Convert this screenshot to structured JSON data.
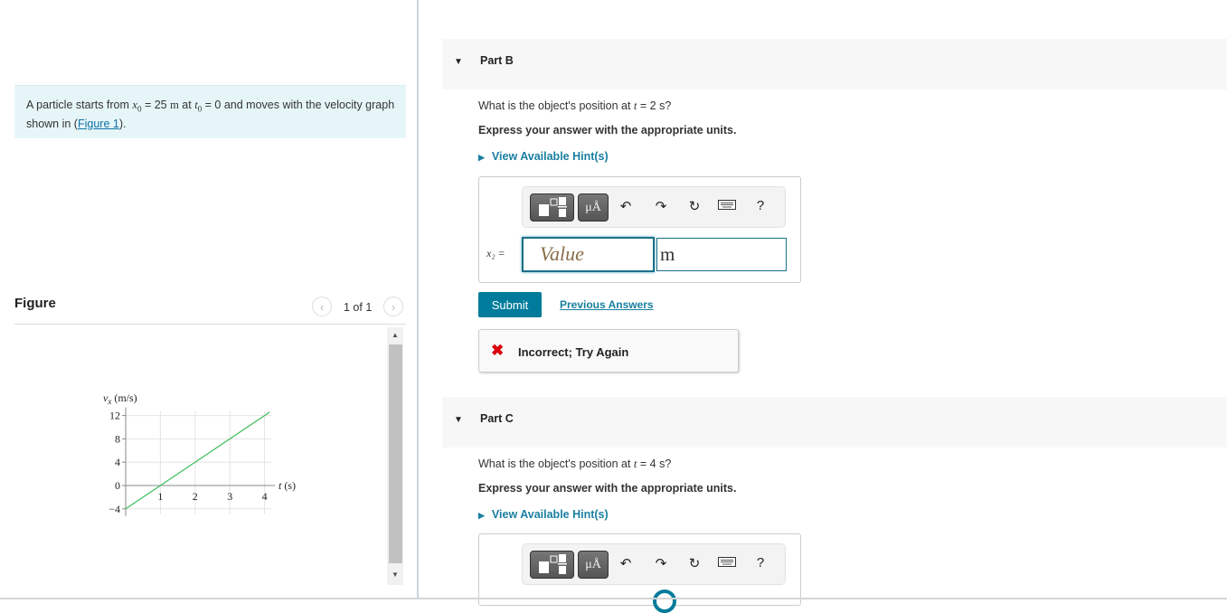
{
  "problem": {
    "text_before": "A particle starts from ",
    "x0_symbol": "x",
    "x0_sub": "0",
    "x0_value": " = 25 ",
    "x0_unit": "m",
    "text_mid": " at ",
    "t0_symbol": "t",
    "t0_sub": "0",
    "t0_value": " = 0 and moves with the velocity graph shown in (",
    "figure_link": "Figure 1",
    "text_after": ")."
  },
  "figure": {
    "title": "Figure",
    "pager": "1 of 1",
    "prev_icon": "chevron-left-icon",
    "next_icon": "chevron-right-icon"
  },
  "chart_data": {
    "type": "line",
    "title": "",
    "xlabel": "t (s)",
    "ylabel": "v_x (m/s)",
    "ylabel_symbol": "v",
    "ylabel_sub": "x",
    "ylabel_unit": "(m/s)",
    "xlabel_symbol": "t",
    "xlabel_unit": "(s)",
    "x_ticks": [
      1,
      2,
      3,
      4
    ],
    "y_ticks": [
      -4,
      0,
      4,
      8,
      12
    ],
    "x_tick_labels": [
      "1",
      "2",
      "3",
      "4"
    ],
    "y_tick_labels": [
      "−4",
      "0",
      "4",
      "8",
      "12"
    ],
    "xlim": [
      0,
      4.2
    ],
    "ylim": [
      -4,
      12.8
    ],
    "grid": true,
    "series": [
      {
        "name": "v_x",
        "color": "#3cbf5a",
        "x": [
          0,
          4.15
        ],
        "y": [
          -4,
          12.6
        ]
      }
    ]
  },
  "partB": {
    "title": "Part B",
    "question_prefix": "What is the object's position at ",
    "question_var": "t",
    "question_suffix": " = 2 s?",
    "instruction": "Express your answer with the appropriate units.",
    "hint": "View Available Hint(s)",
    "answer_label": "x₂ =",
    "value_placeholder": "Value",
    "unit_value": "m",
    "toolbar": {
      "units_label": "μÅ",
      "undo_icon": "↶",
      "redo_icon": "↷",
      "reset_icon": "↻",
      "help_label": "?"
    },
    "submit": "Submit",
    "previous_answers": "Previous Answers",
    "feedback": "Incorrect; Try Again",
    "feedback_icon": "✖"
  },
  "partC": {
    "title": "Part C",
    "question_prefix": "What is the object's position at ",
    "question_var": "t",
    "question_suffix": " = 4 s?",
    "instruction": "Express your answer with the appropriate units.",
    "hint": "View Available Hint(s)",
    "toolbar": {
      "units_label": "μÅ",
      "undo_icon": "↶",
      "redo_icon": "↷",
      "reset_icon": "↻",
      "help_label": "?"
    }
  },
  "colors": {
    "accent": "#007b9b",
    "link": "#1a7fa0",
    "error": "#d9000d",
    "problem_bg": "#e6f6f8",
    "line": "#3cbf5a"
  }
}
